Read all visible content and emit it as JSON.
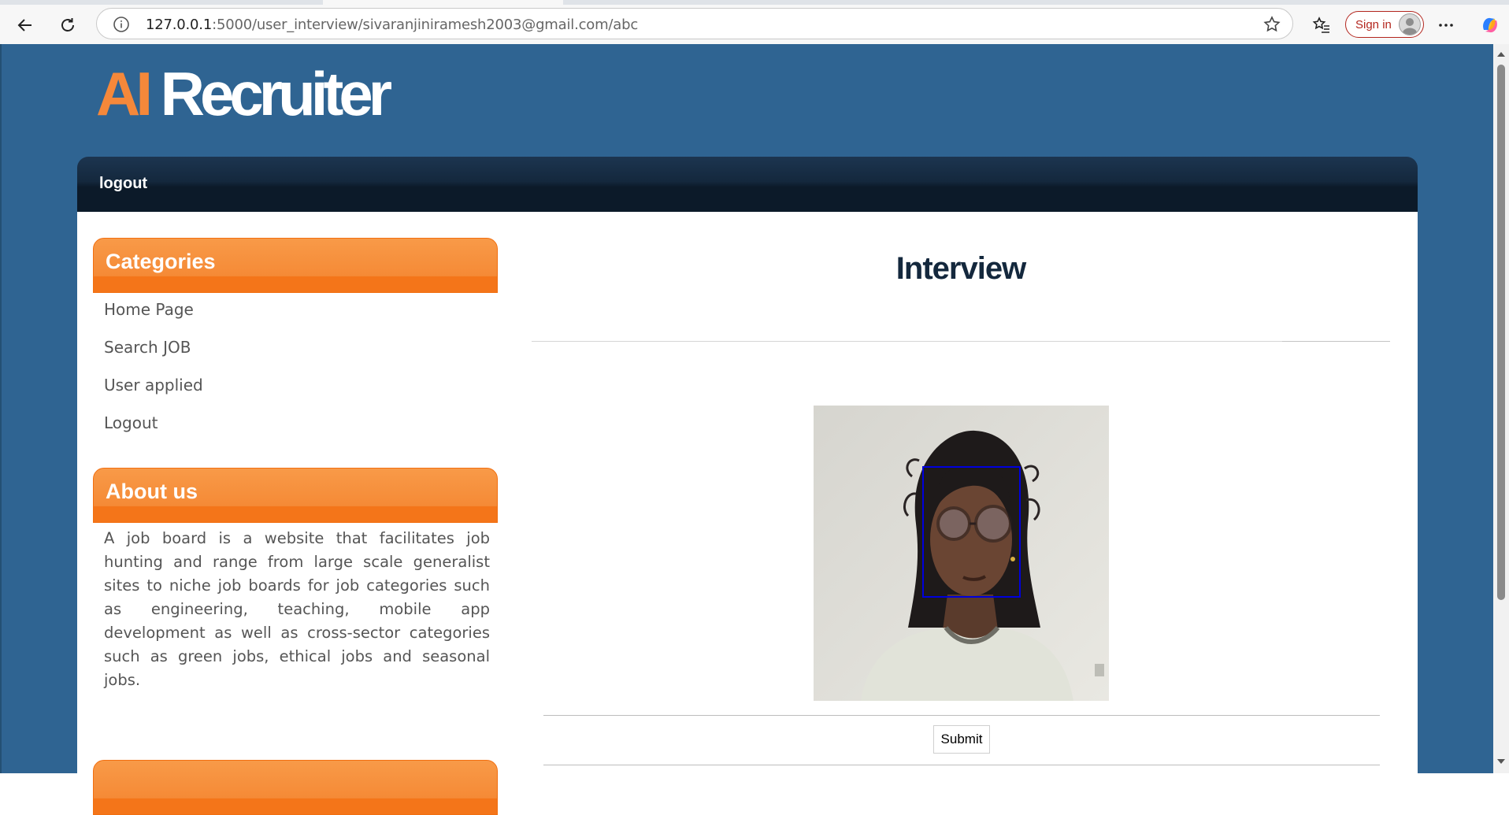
{
  "browser": {
    "url_host": "127.0.0.1",
    "url_path": ":5000/user_interview/sivaranjiniramesh2003@gmail.com/abc",
    "signin_label": "Sign in"
  },
  "site": {
    "logo_ai": "AI",
    "logo_rest": "Recruiter",
    "menu": [
      "logout"
    ]
  },
  "sidebar": {
    "categories_title": "Categories",
    "categories": [
      "Home Page",
      "Search JOB",
      "User applied",
      "Logout"
    ],
    "about_title": "About us",
    "about_text": "A job board is a website that facilitates job hunting and range from large scale generalist sites to niche job boards for job categories such as engineering, teaching, mobile app development as well as cross-sector categories such as green jobs, ethical jobs and seasonal jobs."
  },
  "main": {
    "title": "Interview",
    "submit_label": "Submit"
  },
  "colors": {
    "page_bg": "#2f6492",
    "accent_orange": "#f58a36",
    "menubar": "#14283d",
    "face_box": "#0000dd"
  }
}
